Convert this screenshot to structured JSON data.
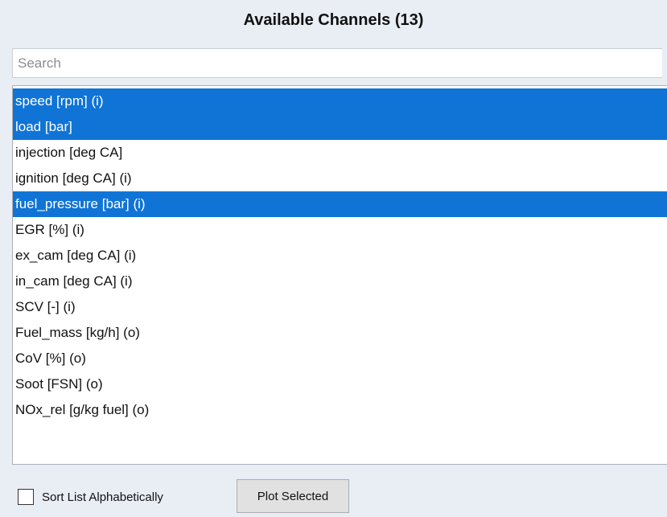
{
  "panel": {
    "title": "Available Channels (13)"
  },
  "search": {
    "placeholder": "Search",
    "value": ""
  },
  "channels": [
    {
      "label": "speed  [rpm] (i)",
      "selected": true
    },
    {
      "label": "load  [bar]",
      "selected": true
    },
    {
      "label": "injection  [deg CA]",
      "selected": false
    },
    {
      "label": "ignition  [deg CA] (i)",
      "selected": false
    },
    {
      "label": "fuel_pressure  [bar] (i)",
      "selected": true
    },
    {
      "label": "EGR  [%] (i)",
      "selected": false
    },
    {
      "label": "ex_cam  [deg CA] (i)",
      "selected": false
    },
    {
      "label": "in_cam  [deg CA] (i)",
      "selected": false
    },
    {
      "label": "SCV  [-] (i)",
      "selected": false
    },
    {
      "label": "Fuel_mass  [kg/h] (o)",
      "selected": false
    },
    {
      "label": "CoV  [%] (o)",
      "selected": false
    },
    {
      "label": "Soot  [FSN] (o)",
      "selected": false
    },
    {
      "label": "NOx_rel  [g/kg fuel] (o)",
      "selected": false
    }
  ],
  "footer": {
    "sort_label": "Sort List Alphabetically",
    "sort_checked": false,
    "plot_button_label": "Plot Selected"
  },
  "colors": {
    "selection": "#0f74d6",
    "background": "#e9eef5"
  }
}
